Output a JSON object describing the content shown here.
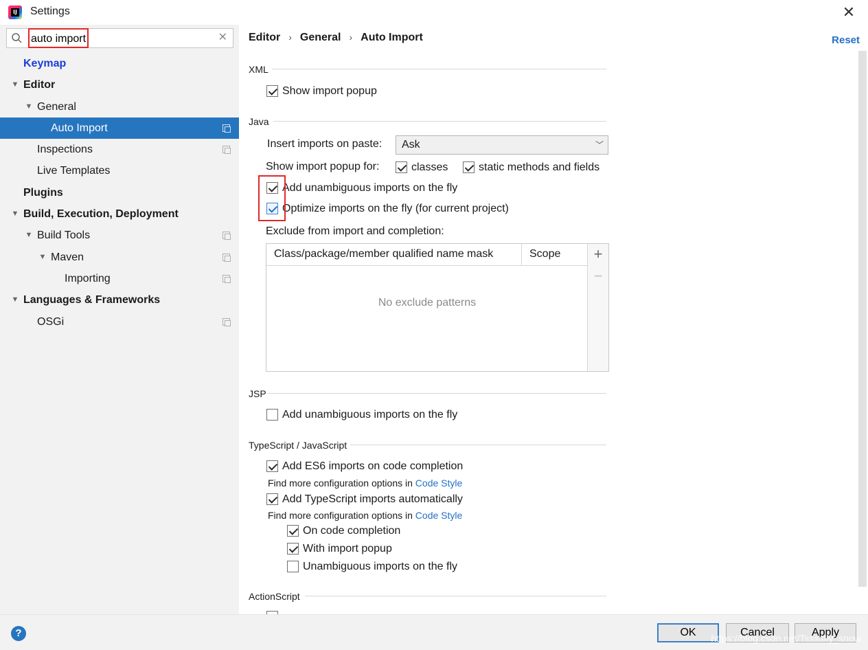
{
  "window": {
    "title": "Settings",
    "close_glyph": "✕"
  },
  "search": {
    "value": "auto import",
    "clear_glyph": "✕"
  },
  "tree": {
    "keymap": "Keymap",
    "editor": "Editor",
    "general": "General",
    "auto_import": "Auto Import",
    "inspections": "Inspections",
    "live_templates": "Live Templates",
    "plugins": "Plugins",
    "build": "Build, Execution, Deployment",
    "build_tools": "Build Tools",
    "maven": "Maven",
    "importing": "Importing",
    "languages": "Languages & Frameworks",
    "osgi": "OSGi"
  },
  "breadcrumb": {
    "part1": "Editor",
    "part2": "General",
    "part3": "Auto Import",
    "sep": "›"
  },
  "reset_label": "Reset",
  "xml": {
    "title": "XML",
    "show_import_popup": "Show import popup"
  },
  "java": {
    "title": "Java",
    "insert_on_paste_label": "Insert imports on paste:",
    "insert_on_paste_value": "Ask",
    "show_popup_for_label": "Show import popup for:",
    "classes": "classes",
    "static_methods": "static methods and fields",
    "add_unambiguous": "Add unambiguous imports on the fly",
    "optimize_imports": "Optimize imports on the fly (for current project)",
    "exclude_label": "Exclude from import and completion:",
    "table_col_mask": "Class/package/member qualified name mask",
    "table_col_scope": "Scope",
    "table_empty": "No exclude patterns",
    "add_glyph": "+",
    "remove_glyph": "−"
  },
  "jsp": {
    "title": "JSP",
    "add_unambiguous": "Add unambiguous imports on the fly"
  },
  "ts": {
    "title": "TypeScript / JavaScript",
    "es6": "Add ES6 imports on code completion",
    "hint_prefix": "Find more configuration options in",
    "hint_link": "Code Style",
    "ts_auto": "Add TypeScript imports automatically",
    "hint2_prefix": "Find more configuration options in",
    "hint2_link": "Code Style",
    "on_completion": "On code completion",
    "with_popup": "With import popup",
    "unambiguous": "Unambiguous imports on the fly"
  },
  "actionscript": {
    "title": "ActionScript"
  },
  "footer": {
    "help": "?",
    "ok": "OK",
    "cancel": "Cancel",
    "apply": "Apply",
    "watermark": "https://blog.csdn.net/Tssssfly_snow"
  }
}
